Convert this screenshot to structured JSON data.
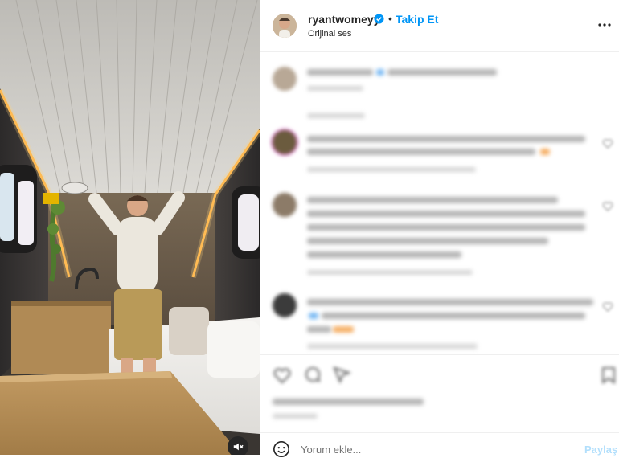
{
  "header": {
    "username": "ryantwomeyy",
    "verified_icon": "verified-badge-icon",
    "separator": "•",
    "follow_label": "Takip Et",
    "audio_label": "Orijinal ses",
    "more_icon": "more-options-icon"
  },
  "media": {
    "mute_icon": "muted-speaker-icon"
  },
  "comment_box": {
    "emoji_icon": "emoji-icon",
    "placeholder": "Yorum ekle...",
    "post_label": "Paylaş"
  },
  "colors": {
    "accent": "#0095f6",
    "post_disabled": "#b2dffc",
    "text": "#262626",
    "secondary_text": "#737373",
    "divider": "#efefef"
  }
}
